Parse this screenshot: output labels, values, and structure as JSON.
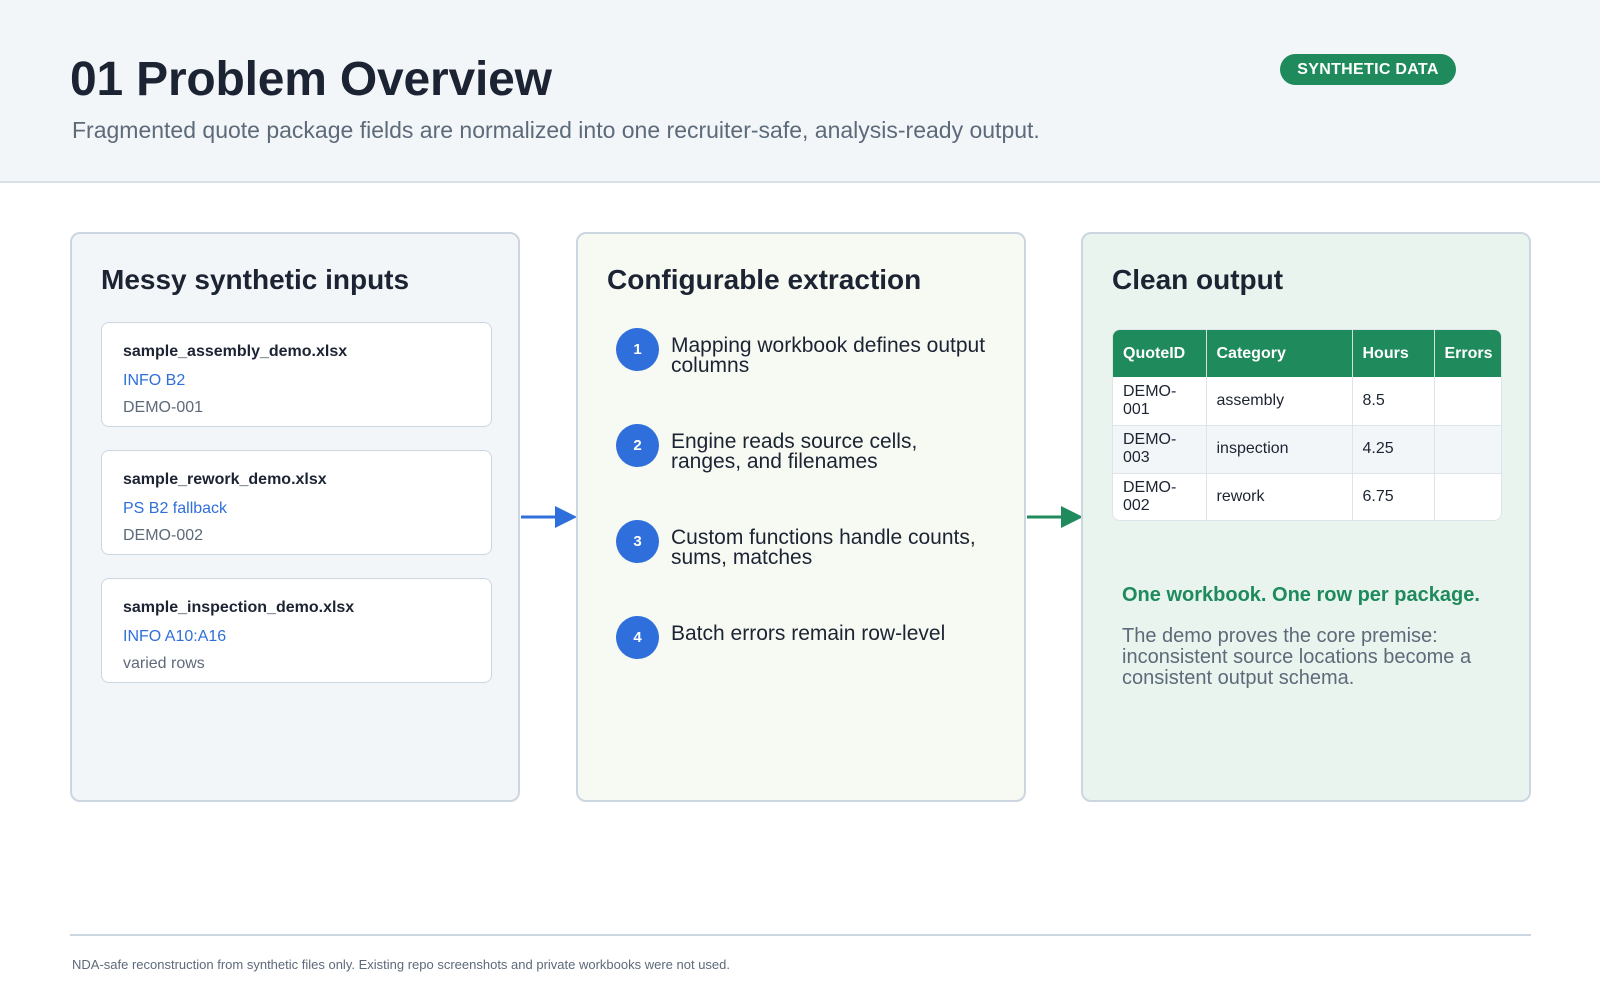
{
  "header": {
    "title": "01 Problem Overview",
    "subtitle": "Fragmented quote package fields are normalized into one recruiter-safe, analysis-ready output.",
    "badge": "SYNTHETIC DATA"
  },
  "inputs": {
    "title": "Messy synthetic inputs",
    "files": [
      {
        "name": "sample_assembly_demo.xlsx",
        "range": "INFO B2",
        "id": "DEMO-001"
      },
      {
        "name": "sample_rework_demo.xlsx",
        "range": "PS B2 fallback",
        "id": "DEMO-002"
      },
      {
        "name": "sample_inspection_demo.xlsx",
        "range": "INFO A10:A16",
        "id": "varied rows"
      }
    ]
  },
  "extraction": {
    "title": "Configurable extraction",
    "steps": [
      {
        "num": "1",
        "text": "Mapping workbook defines output columns"
      },
      {
        "num": "2",
        "text": "Engine reads source cells, ranges, and filenames"
      },
      {
        "num": "3",
        "text": "Custom functions handle counts, sums, matches"
      },
      {
        "num": "4",
        "text": "Batch errors remain row-level"
      }
    ]
  },
  "output": {
    "title": "Clean output",
    "columns": [
      "QuoteID",
      "Category",
      "Hours",
      "Errors"
    ],
    "rows": [
      [
        "DEMO-001",
        "assembly",
        "8.5",
        ""
      ],
      [
        "DEMO-003",
        "inspection",
        "4.25",
        ""
      ],
      [
        "DEMO-002",
        "rework",
        "6.75",
        ""
      ]
    ],
    "tagline": "One workbook. One row per package.",
    "description": "The demo proves the core premise: inconsistent source locations become a consistent output schema."
  },
  "footer": {
    "note": "NDA-safe reconstruction from synthetic files only. Existing repo screenshots and private workbooks were not used."
  },
  "colors": {
    "accent_blue": "#2f6fdb",
    "accent_green": "#1f8a5b",
    "text_dark": "#1c2433",
    "text_muted": "#5d6a79"
  }
}
